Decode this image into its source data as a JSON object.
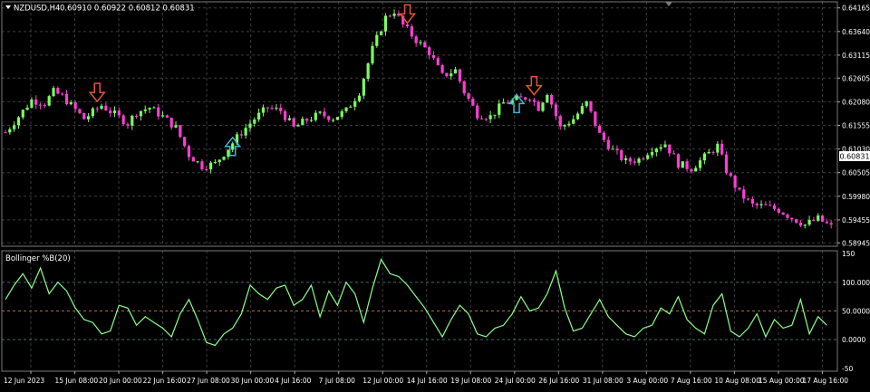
{
  "header": {
    "symbol_text": "NZDUSD,H4",
    "ohlc_text": "0.60910 0.60922 0.60812 0.60831"
  },
  "indicator": {
    "title": "Bollinger %B(20)"
  },
  "colors": {
    "background": "#000000",
    "grid": "#3c3c3c",
    "bull_candle": "#7cfc62",
    "bear_candle": "#ff3dd6",
    "arrow_sell": "#e4553a",
    "arrow_buy": "#3fb6d6",
    "indicator_line": "#8cff8c",
    "level_line": "#3c6f7c",
    "level_50_line": "#b0683a",
    "axis_text": "#ffffff"
  },
  "chart_data": [
    {
      "type": "candlestick",
      "price_axis_labels": [
        "0.64165",
        "0.63640",
        "0.63115",
        "0.62605",
        "0.62080",
        "0.61555",
        "0.61030",
        "0.60505",
        "0.59980",
        "0.59455",
        "0.58945"
      ],
      "current_price_label": "0.60831",
      "ylim": [
        0.5887,
        0.643
      ],
      "time_axis_labels": [
        "12 Jun 2023",
        "15 Jun 08:00",
        "20 Jun 00:00",
        "22 Jun 16:00",
        "27 Jun 08:00",
        "30 Jun 00:00",
        "4 Jul 16:00",
        "7 Jul 08:00",
        "12 Jul 00:00",
        "14 Jul 16:00",
        "19 Jul 08:00",
        "24 Jul 00:00",
        "26 Jul 16:00",
        "31 Jul 08:00",
        "3 Aug 00:00",
        "7 Aug 16:00",
        "10 Aug 08:00",
        "15 Aug 00:00",
        "17 Aug 16:00"
      ],
      "close_path": [
        [
          0,
          0.614
        ],
        [
          3,
          0.6175
        ],
        [
          6,
          0.6212
        ],
        [
          9,
          0.6205
        ],
        [
          11,
          0.623
        ],
        [
          13,
          0.622
        ],
        [
          15,
          0.62
        ],
        [
          18,
          0.617
        ],
        [
          20,
          0.6185
        ],
        [
          22,
          0.62
        ],
        [
          25,
          0.618
        ],
        [
          28,
          0.616
        ],
        [
          30,
          0.6185
        ],
        [
          33,
          0.6195
        ],
        [
          36,
          0.6175
        ],
        [
          39,
          0.615
        ],
        [
          42,
          0.609
        ],
        [
          45,
          0.6065
        ],
        [
          48,
          0.607
        ],
        [
          51,
          0.6105
        ],
        [
          54,
          0.614
        ],
        [
          57,
          0.617
        ],
        [
          60,
          0.6195
        ],
        [
          63,
          0.6188
        ],
        [
          66,
          0.615
        ],
        [
          69,
          0.6168
        ],
        [
          72,
          0.618
        ],
        [
          75,
          0.6172
        ],
        [
          78,
          0.6188
        ],
        [
          81,
          0.623
        ],
        [
          84,
          0.6325
        ],
        [
          87,
          0.6395
        ],
        [
          89,
          0.641
        ],
        [
          91,
          0.6378
        ],
        [
          94,
          0.6345
        ],
        [
          97,
          0.6318
        ],
        [
          100,
          0.6265
        ],
        [
          103,
          0.6278
        ],
        [
          105,
          0.623
        ],
        [
          108,
          0.618
        ],
        [
          111,
          0.6175
        ],
        [
          114,
          0.6205
        ],
        [
          117,
          0.6212
        ],
        [
          120,
          0.622
        ],
        [
          122,
          0.6195
        ],
        [
          124,
          0.623
        ],
        [
          127,
          0.615
        ],
        [
          130,
          0.617
        ],
        [
          133,
          0.6205
        ],
        [
          136,
          0.6135
        ],
        [
          139,
          0.61
        ],
        [
          142,
          0.6075
        ],
        [
          145,
          0.608
        ],
        [
          148,
          0.6105
        ],
        [
          151,
          0.6115
        ],
        [
          154,
          0.607
        ],
        [
          157,
          0.606
        ],
        [
          160,
          0.6085
        ],
        [
          163,
          0.611
        ],
        [
          165,
          0.6055
        ],
        [
          168,
          0.6005
        ],
        [
          171,
          0.5978
        ],
        [
          174,
          0.5975
        ],
        [
          177,
          0.5968
        ],
        [
          180,
          0.595
        ],
        [
          183,
          0.5935
        ],
        [
          186,
          0.5948
        ],
        [
          189,
          0.593
        ]
      ],
      "signal_arrows": [
        {
          "type": "sell",
          "bar": 21
        },
        {
          "type": "buy",
          "bar": 52
        },
        {
          "type": "sell",
          "bar": 92
        },
        {
          "type": "buy",
          "bar": 117
        },
        {
          "type": "sell",
          "bar": 121
        }
      ]
    },
    {
      "type": "line",
      "name": "Bollinger %B(20)",
      "y_axis_labels": [
        "150",
        "100.0000",
        "50.0000",
        "0.0000",
        "-50"
      ],
      "ylim": [
        -55,
        155
      ],
      "levels": [
        100,
        50,
        0
      ],
      "x": [
        0,
        2,
        4,
        6,
        8,
        10,
        12,
        14,
        16,
        18,
        20,
        22,
        24,
        26,
        28,
        30,
        32,
        34,
        36,
        38,
        40,
        42,
        44,
        46,
        48,
        50,
        52,
        54,
        56,
        58,
        60,
        62,
        64,
        66,
        68,
        70,
        72,
        74,
        76,
        78,
        80,
        82,
        84,
        86,
        88,
        90,
        92,
        94,
        96,
        98,
        100,
        102,
        104,
        106,
        108,
        110,
        112,
        114,
        116,
        118,
        120,
        122,
        124,
        126,
        128,
        130,
        132,
        134,
        136,
        138,
        140,
        142,
        144,
        146,
        148,
        150,
        152,
        154,
        156,
        158,
        160,
        162,
        164,
        166,
        168,
        170,
        172,
        174,
        176,
        178,
        180,
        182,
        184,
        186,
        188
      ],
      "values": [
        70,
        95,
        115,
        90,
        125,
        80,
        100,
        85,
        55,
        35,
        30,
        10,
        15,
        60,
        55,
        25,
        40,
        30,
        20,
        5,
        45,
        70,
        35,
        -5,
        -10,
        10,
        20,
        45,
        95,
        80,
        70,
        90,
        95,
        60,
        70,
        95,
        40,
        85,
        60,
        100,
        80,
        30,
        90,
        140,
        115,
        110,
        95,
        75,
        55,
        30,
        5,
        35,
        60,
        45,
        10,
        5,
        20,
        25,
        45,
        75,
        50,
        55,
        80,
        120,
        55,
        15,
        20,
        45,
        70,
        40,
        25,
        10,
        5,
        20,
        25,
        55,
        45,
        75,
        35,
        20,
        10,
        60,
        80,
        15,
        5,
        20,
        45,
        5,
        35,
        20,
        25,
        70,
        10,
        40,
        25
      ]
    }
  ]
}
